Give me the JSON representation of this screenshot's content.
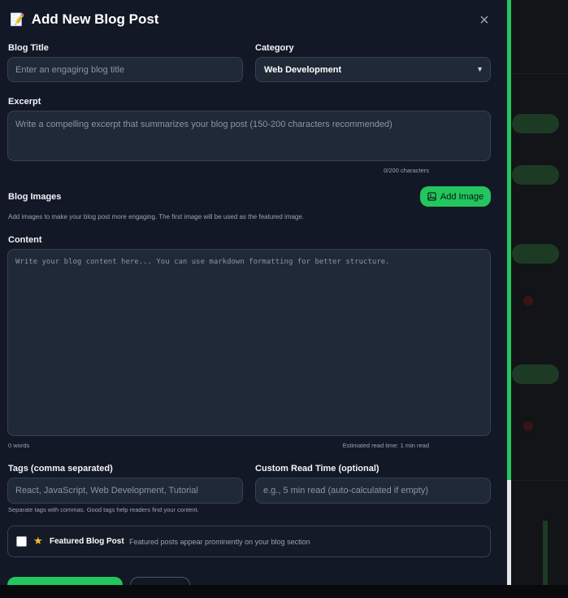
{
  "modal": {
    "title": "Add New Blog Post",
    "title_icon": "memo-icon",
    "close_icon": "close-icon"
  },
  "form": {
    "blog_title": {
      "label": "Blog Title",
      "placeholder": "Enter an engaging blog title",
      "value": ""
    },
    "category": {
      "label": "Category",
      "selected": "Web Development"
    },
    "excerpt": {
      "label": "Excerpt",
      "placeholder": "Write a compelling excerpt that summarizes your blog post (150-200 characters recommended)",
      "value": "",
      "counter": "0/200 characters"
    },
    "images": {
      "label": "Blog Images",
      "button_label": "Add Image",
      "button_icon": "image-icon",
      "helper": "Add images to make your blog post more engaging. The first image will be used as the featured image."
    },
    "content": {
      "label": "Content",
      "placeholder": "Write your blog content here... You can use markdown formatting for better structure.",
      "value": "",
      "word_count": "0 words",
      "read_time": "Estimated read time: 1 min read"
    },
    "tags": {
      "label": "Tags (comma separated)",
      "placeholder": "React, JavaScript, Web Development, Tutorial",
      "value": "",
      "helper": "Separate tags with commas. Good tags help readers find your content."
    },
    "read_time": {
      "label": "Custom Read Time (optional)",
      "placeholder": "e.g., 5 min read (auto-calculated if empty)",
      "value": ""
    },
    "featured": {
      "label": "Featured Blog Post",
      "description": "Featured posts appear prominently on your blog section",
      "checked": false,
      "icon": "star-icon"
    }
  },
  "colors": {
    "accent": "#22c55e",
    "modal_bg": "#121826",
    "field_bg": "#1f2937",
    "field_border": "#374151"
  }
}
